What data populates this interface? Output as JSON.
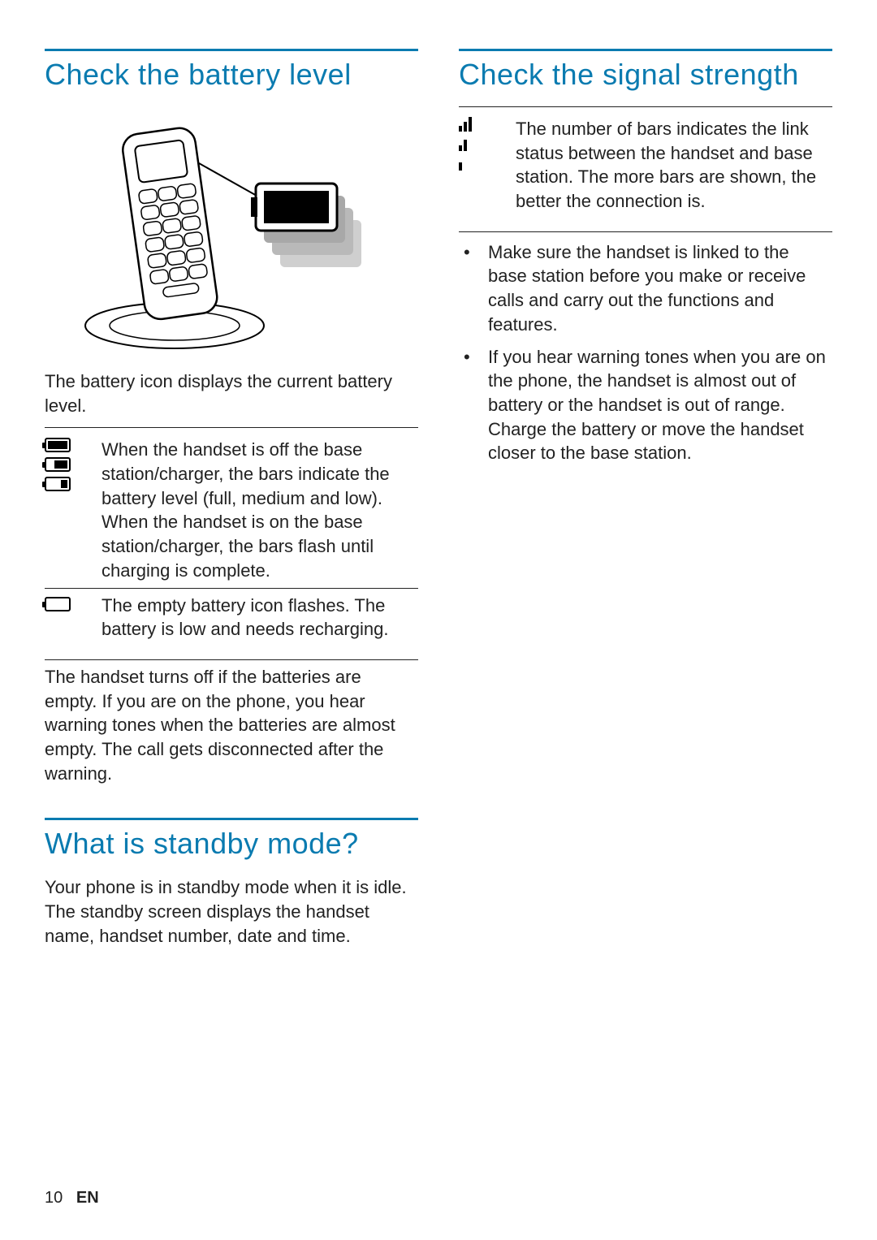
{
  "left": {
    "battery_heading": "Check the battery level",
    "battery_caption": "The battery icon displays the current battery level.",
    "battery_rows": [
      "When the handset is off the base station/charger, the bars indicate the battery level (full, medium and low). When the handset is on the base station/charger, the bars flash until charging is complete.",
      "The empty battery icon flashes. The battery is low and needs recharging."
    ],
    "battery_footer": "The handset turns off if the batteries are empty. If you are on the phone, you hear warning tones when the batteries are almost empty. The call gets disconnected after the warning.",
    "standby_heading": "What is standby mode?",
    "standby_body": "Your phone is in standby mode when it is idle. The standby screen displays the handset name, handset number, date and time."
  },
  "right": {
    "signal_heading": "Check the signal strength",
    "signal_row": "The number of bars indicates the link status between the handset and base station. The more bars are shown, the better the connection is.",
    "signal_bullets": [
      "Make sure the handset is linked to the base station before you make or receive calls and carry out the functions and features.",
      "If you hear warning tones when you are on the phone, the handset is almost out of battery or the handset is out of range. Charge the battery or move the handset closer to the base station."
    ]
  },
  "footer": {
    "page": "10",
    "lang": "EN"
  }
}
